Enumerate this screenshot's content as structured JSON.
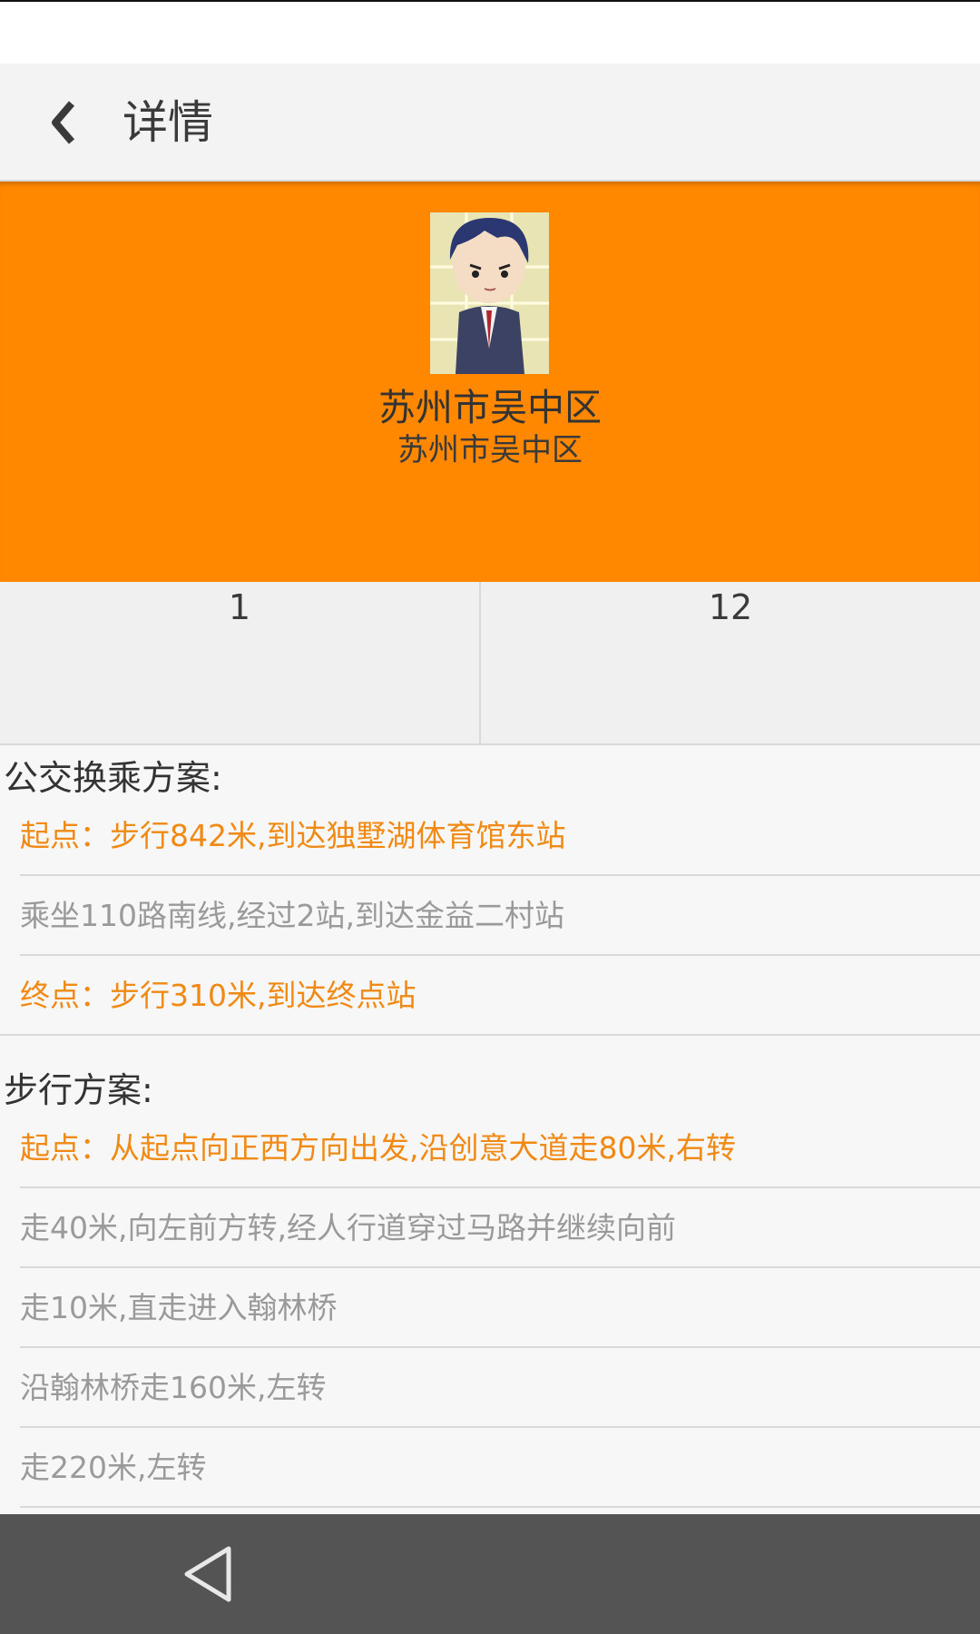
{
  "toolbar": {
    "title": "详情"
  },
  "profile": {
    "name": "苏州市吴中区",
    "subtitle": "苏州市吴中区"
  },
  "stats": {
    "left": "1",
    "right": "12"
  },
  "bus": {
    "title": "公交换乘方案:",
    "steps": [
      "起点：步行842米,到达独墅湖体育馆东站",
      "乘坐110路南线,经过2站,到达金益二村站",
      "终点：步行310米,到达终点站"
    ]
  },
  "walk": {
    "title": "步行方案:",
    "steps": [
      "起点：从起点向正西方向出发,沿创意大道走80米,右转",
      "走40米,向左前方转,经人行道穿过马路并继续向前",
      "走10米,直走进入翰林桥",
      "沿翰林桥走160米,左转",
      "走220米,左转"
    ]
  },
  "colors": {
    "accent": "#ff8800",
    "highlight_text": "#f08a14",
    "muted_text": "#9a9a9a"
  },
  "icons": {
    "back": "chevron-left-icon",
    "nav_back": "triangle-back-icon"
  }
}
